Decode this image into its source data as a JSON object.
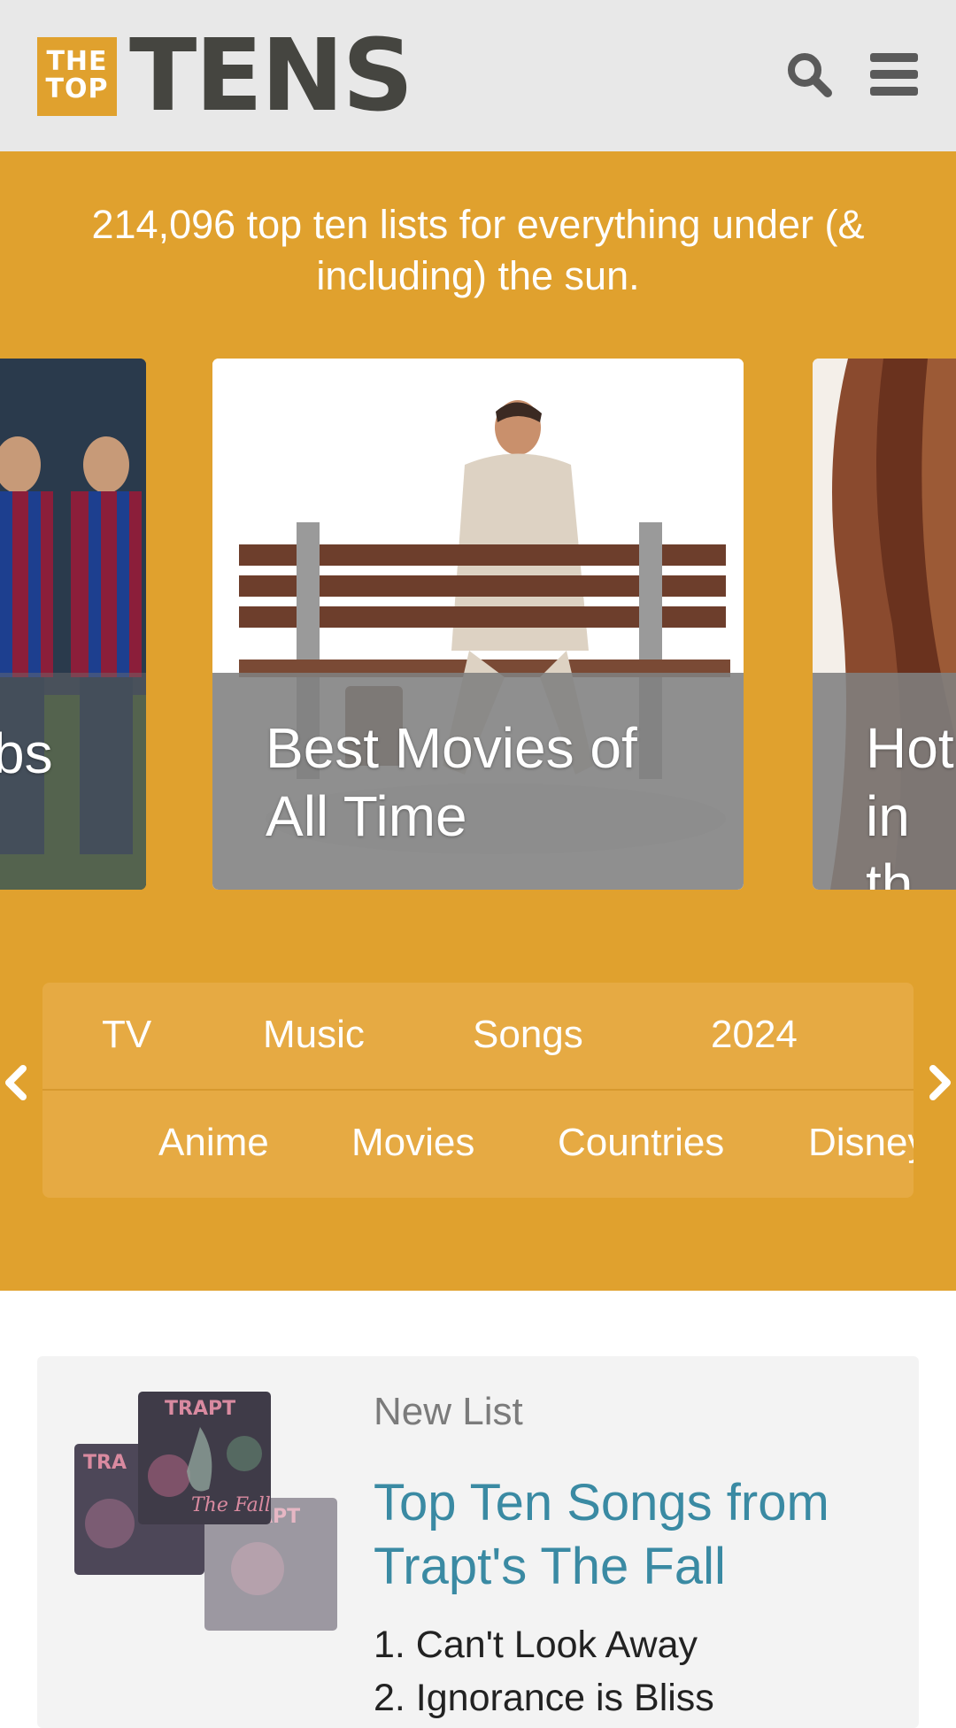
{
  "header": {
    "logo_small_line1": "THE",
    "logo_small_line2": "TOP",
    "logo_big": "TENS",
    "search_icon": "search-icon",
    "menu_icon": "hamburger-menu-icon"
  },
  "hero": {
    "tagline": "214,096 top ten lists for everything under (& including) the sun.",
    "cards": [
      {
        "title": "bs",
        "art": "soccer-players-image"
      },
      {
        "title": "Best Movies of All Time",
        "art": "man-on-bench-image"
      },
      {
        "title": "Hot in th",
        "art": "woman-hair-image"
      }
    ]
  },
  "categories": {
    "row1": [
      "TV",
      "Music",
      "Songs",
      "2024"
    ],
    "row2": [
      "Anime",
      "Movies",
      "Countries",
      "Disney"
    ],
    "prev_icon": "chevron-left-icon",
    "next_icon": "chevron-right-icon"
  },
  "new_list": {
    "badge": "New List",
    "title": "Top Ten Songs from Trapt's The Fall",
    "items": [
      "1. Can't Look Away",
      "2. Ignorance is Bliss"
    ],
    "album_label": "TRAPT",
    "album_script": "The Fall"
  },
  "colors": {
    "accent": "#e0a12e",
    "header_bg": "#e8e8e8",
    "link": "#3a8aa3"
  }
}
